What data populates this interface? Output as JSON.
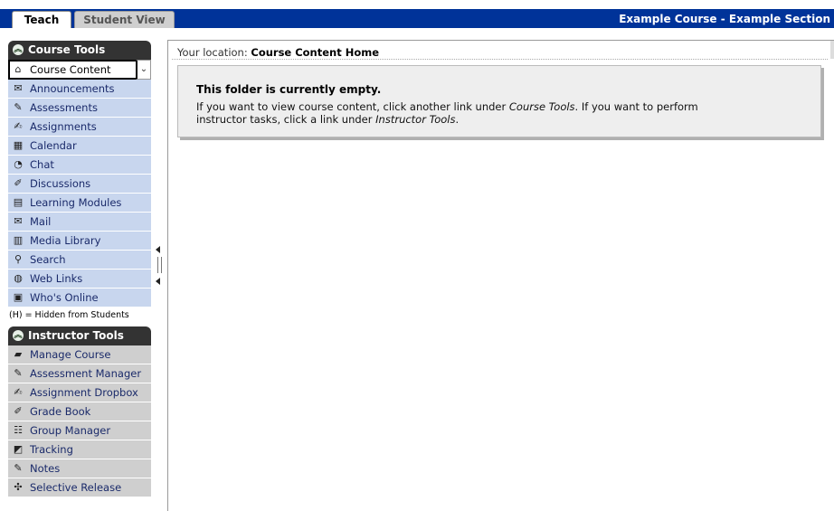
{
  "tabs": {
    "teach": "Teach",
    "student_view": "Student View"
  },
  "course_title": "Example Course - Example Section",
  "course_tools": {
    "header": "Course Tools",
    "selected": {
      "label": "Course Content",
      "icon": "home-icon"
    },
    "items": [
      {
        "label": "Announcements",
        "icon": "megaphone-icon"
      },
      {
        "label": "Assessments",
        "icon": "assessment-icon"
      },
      {
        "label": "Assignments",
        "icon": "assignment-icon"
      },
      {
        "label": "Calendar",
        "icon": "calendar-icon"
      },
      {
        "label": "Chat",
        "icon": "chat-bubble-icon"
      },
      {
        "label": "Discussions",
        "icon": "pushpin-icon"
      },
      {
        "label": "Learning Modules",
        "icon": "document-icon"
      },
      {
        "label": "Mail",
        "icon": "envelope-icon"
      },
      {
        "label": "Media Library",
        "icon": "book-icon"
      },
      {
        "label": "Search",
        "icon": "magnifier-icon"
      },
      {
        "label": "Web Links",
        "icon": "globe-icon"
      },
      {
        "label": "Who's Online",
        "icon": "person-card-icon"
      }
    ],
    "hidden_note": "(H) = Hidden from Students"
  },
  "instructor_tools": {
    "header": "Instructor Tools",
    "items": [
      {
        "label": "Manage Course",
        "icon": "toolbox-icon"
      },
      {
        "label": "Assessment Manager",
        "icon": "assessment-manager-icon"
      },
      {
        "label": "Assignment Dropbox",
        "icon": "dropbox-icon"
      },
      {
        "label": "Grade Book",
        "icon": "gradebook-icon"
      },
      {
        "label": "Group Manager",
        "icon": "group-icon"
      },
      {
        "label": "Tracking",
        "icon": "chart-icon"
      },
      {
        "label": "Notes",
        "icon": "note-icon"
      },
      {
        "label": "Selective Release",
        "icon": "release-icon"
      }
    ]
  },
  "main": {
    "location_label": "Your location:",
    "location_value": "Course Content Home",
    "empty_title": "This folder is currently empty.",
    "empty_body_1": "If you want to view course content, click another link under ",
    "empty_link_1": "Course Tools",
    "empty_body_2": ". If you want to perform instructor tasks, click a link under ",
    "empty_link_2": "Instructor Tools",
    "empty_body_3": "."
  },
  "colors": {
    "nav_blue": "#003399",
    "tool_row": "#c8d6ee",
    "instr_row": "#cfcfcf",
    "header_dark": "#333333"
  }
}
